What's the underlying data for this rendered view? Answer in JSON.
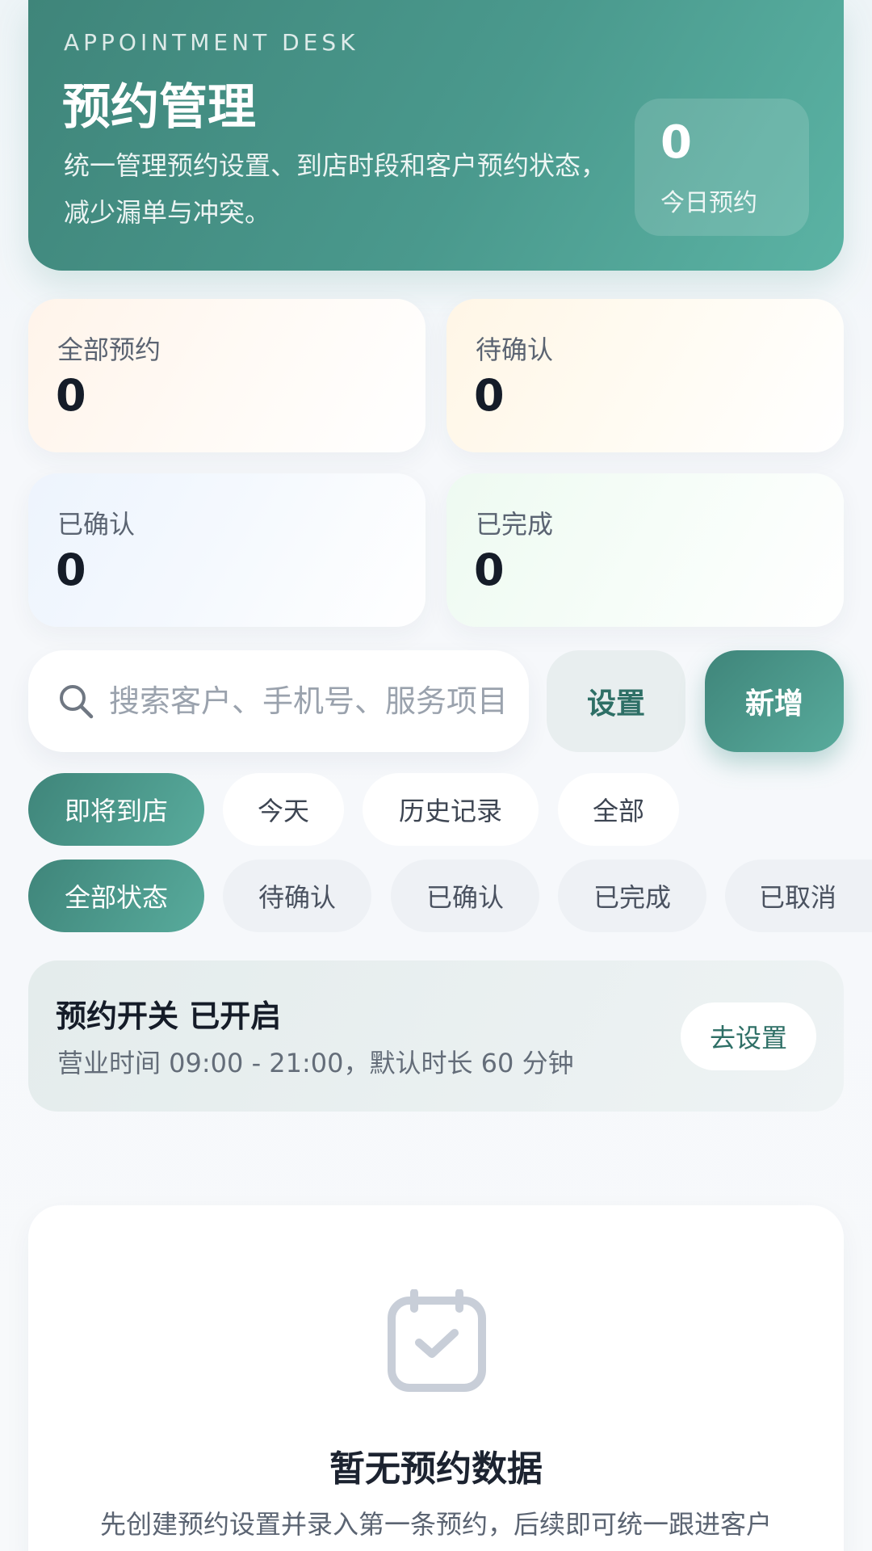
{
  "hero": {
    "eyebrow": "APPOINTMENT DESK",
    "title": "预约管理",
    "description": "统一管理预约设置、到店时段和客户预约状态，减少漏单与冲突。",
    "today_count": "0",
    "today_label": "今日预约"
  },
  "stats": [
    {
      "label": "全部预约",
      "value": "0"
    },
    {
      "label": "待确认",
      "value": "0"
    },
    {
      "label": "已确认",
      "value": "0"
    },
    {
      "label": "已完成",
      "value": "0"
    }
  ],
  "search": {
    "placeholder": "搜索客户、手机号、服务项目"
  },
  "actions": {
    "settings_label": "设置",
    "add_label": "新增"
  },
  "time_filters": [
    {
      "label": "即将到店",
      "active": true
    },
    {
      "label": "今天",
      "active": false
    },
    {
      "label": "历史记录",
      "active": false
    },
    {
      "label": "全部",
      "active": false
    }
  ],
  "status_filters": [
    {
      "label": "全部状态",
      "active": true
    },
    {
      "label": "待确认",
      "active": false
    },
    {
      "label": "已确认",
      "active": false
    },
    {
      "label": "已完成",
      "active": false
    },
    {
      "label": "已取消",
      "active": false
    }
  ],
  "booking_switch": {
    "title": "预约开关 已开启",
    "description": "营业时间 09:00 - 21:00，默认时长 60 分钟",
    "button_label": "去设置"
  },
  "empty_state": {
    "icon": "calendar-check-icon",
    "title": "暂无预约数据",
    "description": "先创建预约设置并录入第一条预约，后续即可统一跟进客户"
  },
  "colors": {
    "accent": "#4a998d",
    "accent_dark": "#3f857a",
    "accent_text": "#2e6f66"
  }
}
